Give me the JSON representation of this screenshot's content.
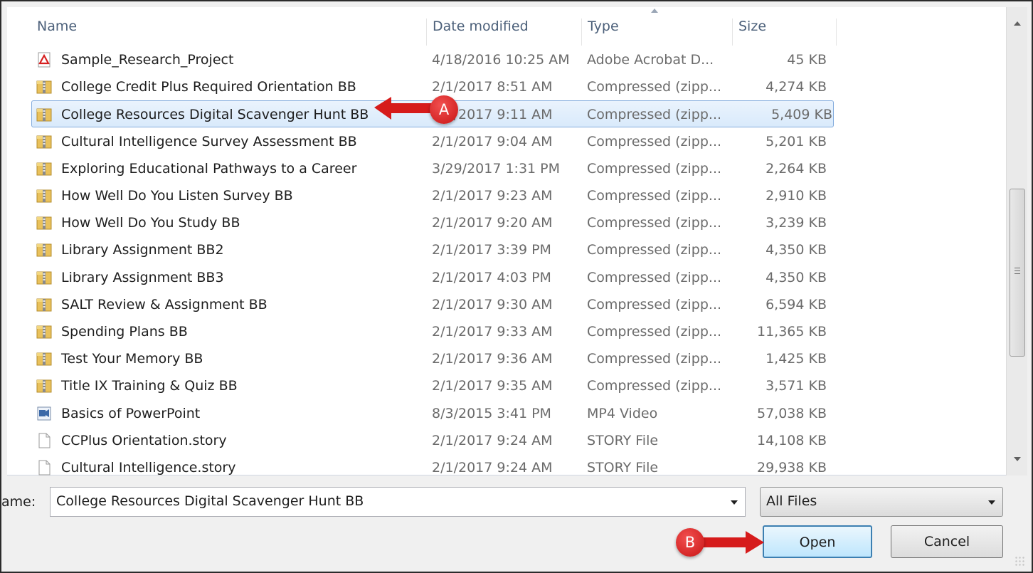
{
  "columns": {
    "name": "Name",
    "date": "Date modified",
    "type": "Type",
    "size": "Size"
  },
  "files": [
    {
      "name": "Sample_Research_Project",
      "date": "4/18/2016 10:25 AM",
      "type": "Adobe Acrobat D...",
      "size": "45 KB",
      "icon": "pdf-icon"
    },
    {
      "name": "College Credit Plus Required Orientation BB",
      "date": "2/1/2017 8:51 AM",
      "type": "Compressed (zipp...",
      "size": "4,274 KB",
      "icon": "zip-folder-icon"
    },
    {
      "name": "College Resources Digital Scavenger Hunt BB",
      "date": "2/1/2017 9:11 AM",
      "type": "Compressed (zipp...",
      "size": "5,409 KB",
      "icon": "zip-folder-icon",
      "selected": true
    },
    {
      "name": "Cultural Intelligence Survey Assessment BB",
      "date": "2/1/2017 9:04 AM",
      "type": "Compressed (zipp...",
      "size": "5,201 KB",
      "icon": "zip-folder-icon"
    },
    {
      "name": "Exploring Educational Pathways to a Career",
      "date": "3/29/2017 1:31 PM",
      "type": "Compressed (zipp...",
      "size": "2,264 KB",
      "icon": "zip-folder-icon"
    },
    {
      "name": "How Well Do You Listen Survey BB",
      "date": "2/1/2017 9:23 AM",
      "type": "Compressed (zipp...",
      "size": "2,910 KB",
      "icon": "zip-folder-icon"
    },
    {
      "name": "How Well Do You Study BB",
      "date": "2/1/2017 9:20 AM",
      "type": "Compressed (zipp...",
      "size": "3,239 KB",
      "icon": "zip-folder-icon"
    },
    {
      "name": "Library Assignment BB2",
      "date": "2/1/2017 3:39 PM",
      "type": "Compressed (zipp...",
      "size": "4,350 KB",
      "icon": "zip-folder-icon"
    },
    {
      "name": "Library Assignment BB3",
      "date": "2/1/2017 4:03 PM",
      "type": "Compressed (zipp...",
      "size": "4,350 KB",
      "icon": "zip-folder-icon"
    },
    {
      "name": "SALT Review & Assignment BB",
      "date": "2/1/2017 9:30 AM",
      "type": "Compressed (zipp...",
      "size": "6,594 KB",
      "icon": "zip-folder-icon"
    },
    {
      "name": "Spending Plans BB",
      "date": "2/1/2017 9:33 AM",
      "type": "Compressed (zipp...",
      "size": "11,365 KB",
      "icon": "zip-folder-icon"
    },
    {
      "name": "Test Your Memory BB",
      "date": "2/1/2017 9:36 AM",
      "type": "Compressed (zipp...",
      "size": "1,425 KB",
      "icon": "zip-folder-icon"
    },
    {
      "name": "Title IX Training & Quiz BB",
      "date": "2/1/2017 9:35 AM",
      "type": "Compressed (zipp...",
      "size": "3,571 KB",
      "icon": "zip-folder-icon"
    },
    {
      "name": "Basics of PowerPoint",
      "date": "8/3/2015 3:41 PM",
      "type": "MP4 Video",
      "size": "57,038 KB",
      "icon": "video-file-icon"
    },
    {
      "name": "CCPlus Orientation.story",
      "date": "2/1/2017 9:24 AM",
      "type": "STORY File",
      "size": "14,108 KB",
      "icon": "blank-file-icon"
    },
    {
      "name": "Cultural Intelligence.story",
      "date": "2/1/2017 9:24 AM",
      "type": "STORY File",
      "size": "29,938 KB",
      "icon": "blank-file-icon"
    }
  ],
  "filename": {
    "label": "ame:",
    "value": "College Resources Digital Scavenger Hunt BB"
  },
  "filetype": {
    "selected": "All Files"
  },
  "buttons": {
    "open": "Open",
    "cancel": "Cancel"
  },
  "callouts": {
    "a": "A",
    "b": "B"
  },
  "colors": {
    "callout": "#d61b1b",
    "selection": "#d9eafb",
    "selection_border": "#84acdd"
  }
}
